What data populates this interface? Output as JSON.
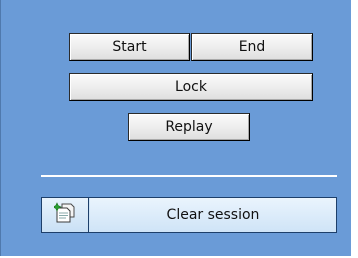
{
  "buttons": {
    "start": "Start",
    "end": "End",
    "lock": "Lock",
    "replay": "Replay"
  },
  "clear_session": {
    "label": "Clear session",
    "icon": "clear-session-icon"
  },
  "colors": {
    "panel_bg": "#6a9bd7",
    "clear_bg": "#cfe5f8",
    "divider": "#ffffff"
  }
}
